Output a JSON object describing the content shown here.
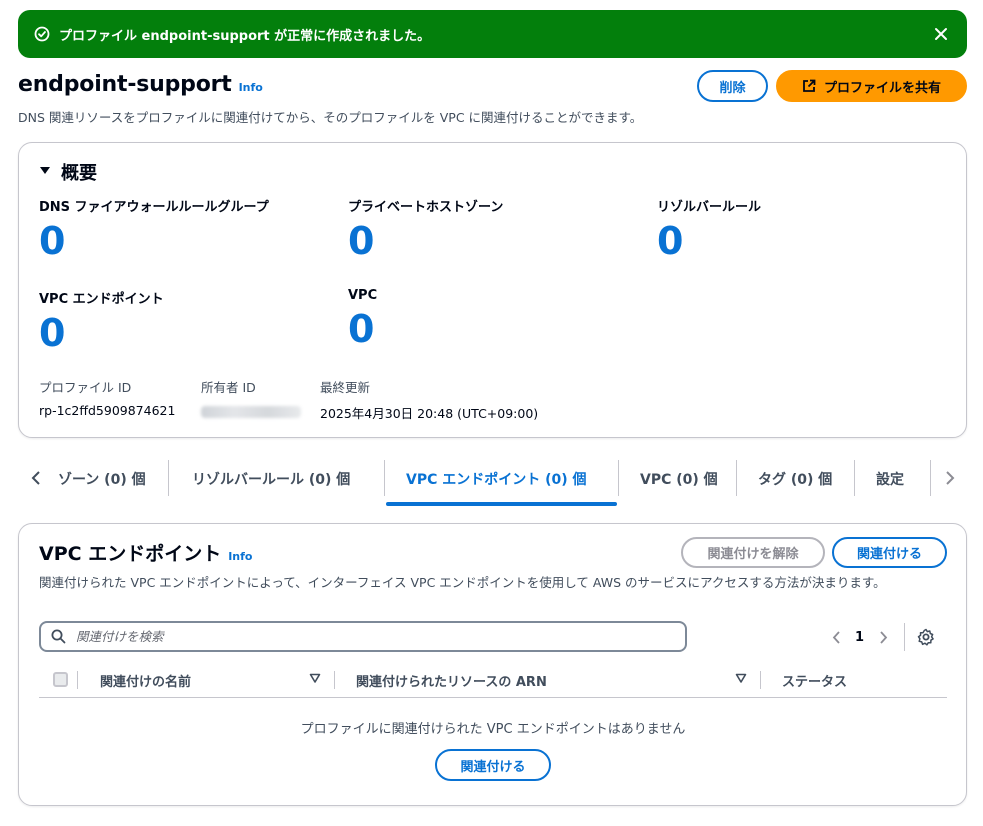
{
  "flash": {
    "message": "プロファイル endpoint-support が正常に作成されました。"
  },
  "header": {
    "title": "endpoint-support",
    "info": "Info",
    "description": "DNS 関連リソースをプロファイルに関連付けてから、そのプロファイルを VPC に関連付けることができます。",
    "delete_label": "削除",
    "share_label": "プロファイルを共有"
  },
  "overview": {
    "title": "概要",
    "stats": [
      {
        "label": "DNS ファイアウォールルールグループ",
        "value": "0"
      },
      {
        "label": "プライベートホストゾーン",
        "value": "0"
      },
      {
        "label": "リゾルバールール",
        "value": "0"
      },
      {
        "label": "VPC エンドポイント",
        "value": "0"
      },
      {
        "label": "VPC",
        "value": "0"
      }
    ],
    "profile_id_label": "プロファイル ID",
    "profile_id": "rp-1c2ffd5909874621",
    "owner_id_label": "所有者 ID",
    "last_updated_label": "最終更新",
    "last_updated": "2025年4月30日 20:48 (UTC+09:00)"
  },
  "tabs": {
    "items": [
      {
        "label": "ゾーン (0) 個"
      },
      {
        "label": "リゾルバールール (0) 個"
      },
      {
        "label": "VPC エンドポイント (0) 個"
      },
      {
        "label": "VPC (0) 個"
      },
      {
        "label": "タグ (0) 個"
      },
      {
        "label": "設定"
      }
    ],
    "active_index": 2
  },
  "vpc_endpoints": {
    "title": "VPC エンドポイント",
    "info": "Info",
    "disassociate_label": "関連付けを解除",
    "associate_label": "関連付ける",
    "description": "関連付けられた VPC エンドポイントによって、インターフェイス VPC エンドポイントを使用して AWS のサービスにアクセスする方法が決まります。",
    "search_placeholder": "関連付けを検索",
    "page": "1",
    "columns": [
      "関連付けの名前",
      "関連付けられたリソースの ARN",
      "ステータス"
    ],
    "empty_message": "プロファイルに関連付けられた VPC エンドポイントはありません",
    "empty_associate_label": "関連付ける"
  },
  "colors": {
    "success": "#037f0c",
    "link": "#0972d3",
    "primary": "#ff9900"
  }
}
